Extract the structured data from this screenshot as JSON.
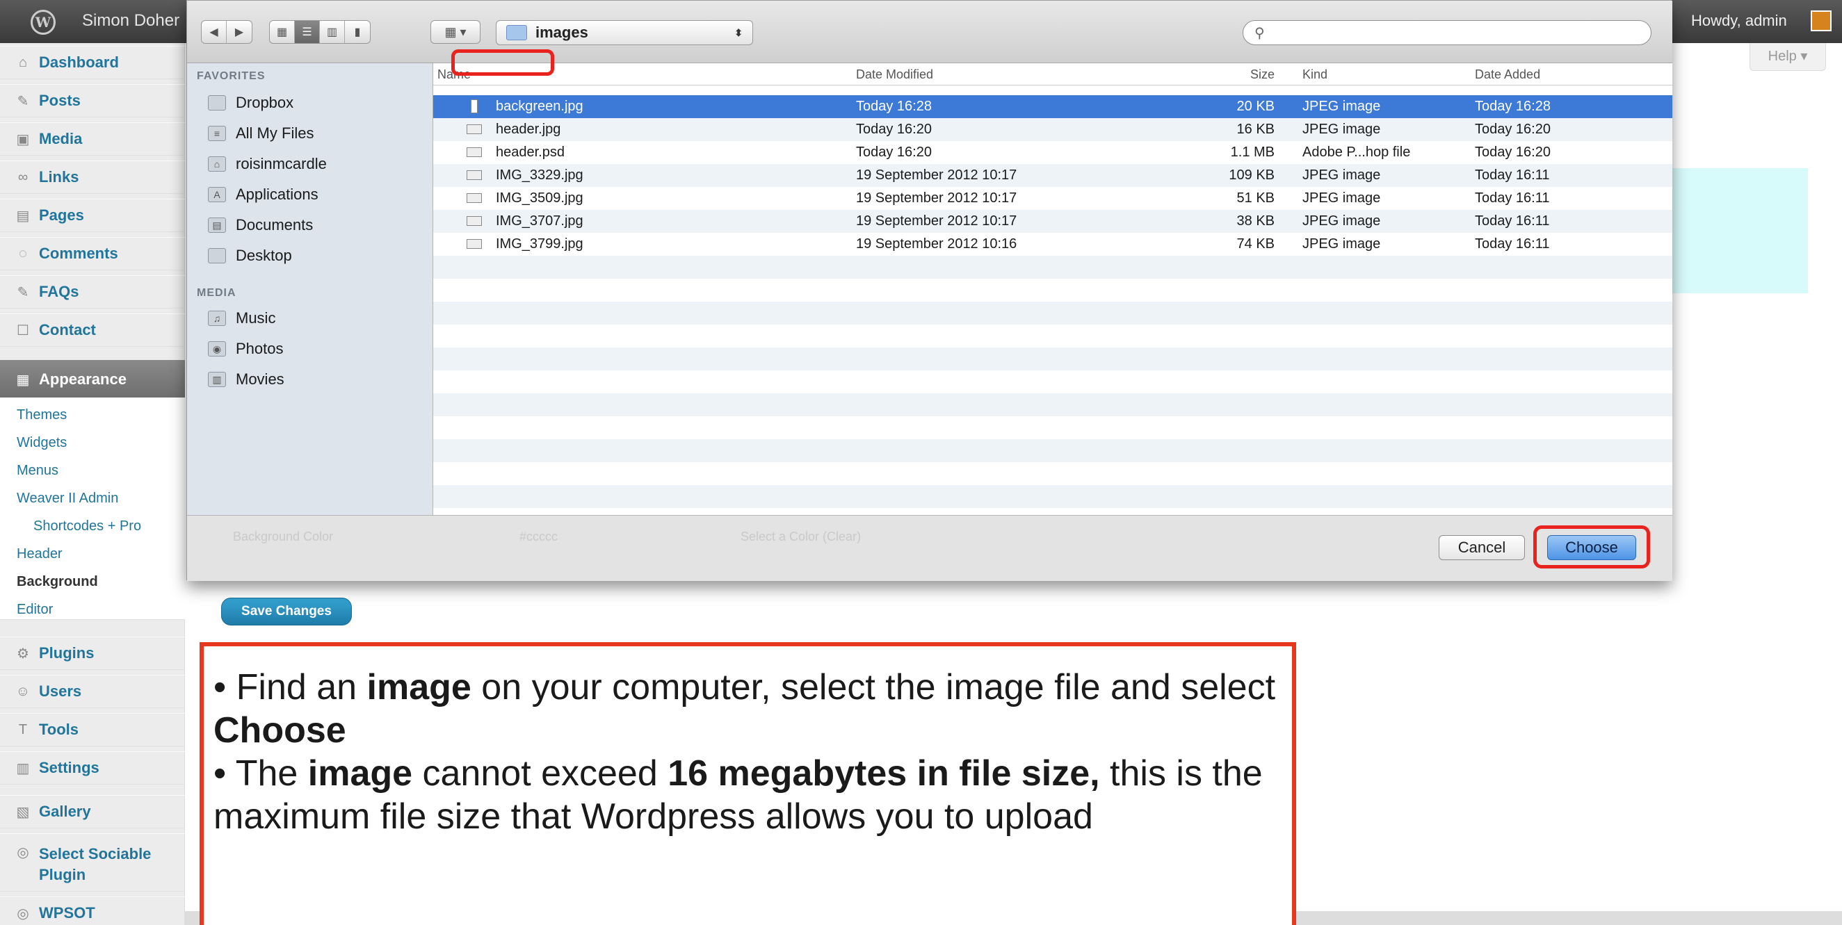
{
  "admin_bar": {
    "site_name": "Simon Doher",
    "howdy": "Howdy, admin",
    "help": "Help ▾"
  },
  "sidebar": {
    "items": [
      {
        "label": "Dashboard",
        "icon": "house-icon"
      },
      {
        "label": "Posts",
        "icon": "pin-icon"
      },
      {
        "label": "Media",
        "icon": "media-icon"
      },
      {
        "label": "Links",
        "icon": "link-icon"
      },
      {
        "label": "Pages",
        "icon": "page-icon"
      },
      {
        "label": "Comments",
        "icon": "comment-icon"
      },
      {
        "label": "FAQs",
        "icon": "pin-icon"
      },
      {
        "label": "Contact",
        "icon": "contact-icon"
      },
      {
        "label": "Appearance",
        "icon": "appearance-icon"
      },
      {
        "label": "Plugins",
        "icon": "plugin-icon"
      },
      {
        "label": "Users",
        "icon": "users-icon"
      },
      {
        "label": "Tools",
        "icon": "tools-icon"
      },
      {
        "label": "Settings",
        "icon": "settings-icon"
      },
      {
        "label": "Gallery",
        "icon": "gallery-icon"
      },
      {
        "label": "Select Sociable Plugin",
        "icon": "sociable-icon"
      },
      {
        "label": "WPSOT",
        "icon": "wpsot-icon"
      }
    ],
    "submenu": [
      "Themes",
      "Widgets",
      "Menus",
      "Weaver II Admin",
      "Shortcodes + Pro",
      "Header",
      "Background",
      "Editor"
    ]
  },
  "page": {
    "save_changes": "Save Changes"
  },
  "dialog": {
    "location": "images",
    "search_placeholder": "",
    "favorites_header": "FAVORITES",
    "favorites": [
      "Dropbox",
      "All My Files",
      "roisinmcardle",
      "Applications",
      "Documents",
      "Desktop"
    ],
    "media_header": "MEDIA",
    "media": [
      "Music",
      "Photos",
      "Movies"
    ],
    "columns": {
      "name": "Name",
      "date_modified": "Date Modified",
      "size": "Size",
      "kind": "Kind",
      "date_added": "Date Added"
    },
    "files": [
      {
        "name": "backgreen.jpg",
        "modified": "Today 16:28",
        "size": "20 KB",
        "kind": "JPEG image",
        "added": "Today 16:28",
        "selected": true
      },
      {
        "name": "header.jpg",
        "modified": "Today 16:20",
        "size": "16 KB",
        "kind": "JPEG image",
        "added": "Today 16:20"
      },
      {
        "name": "header.psd",
        "modified": "Today 16:20",
        "size": "1.1 MB",
        "kind": "Adobe P...hop file",
        "added": "Today 16:20"
      },
      {
        "name": "IMG_3329.jpg",
        "modified": "19 September 2012 10:17",
        "size": "109 KB",
        "kind": "JPEG image",
        "added": "Today 16:11"
      },
      {
        "name": "IMG_3509.jpg",
        "modified": "19 September 2012 10:17",
        "size": "51 KB",
        "kind": "JPEG image",
        "added": "Today 16:11"
      },
      {
        "name": "IMG_3707.jpg",
        "modified": "19 September 2012 10:17",
        "size": "38 KB",
        "kind": "JPEG image",
        "added": "Today 16:11"
      },
      {
        "name": "IMG_3799.jpg",
        "modified": "19 September 2012 10:16",
        "size": "74 KB",
        "kind": "JPEG image",
        "added": "Today 16:11"
      }
    ],
    "ghost_labels": [
      "Background Color",
      "#ccccc",
      "Select a Color (Clear)"
    ],
    "cancel": "Cancel",
    "choose": "Choose"
  },
  "note": {
    "line1_a": "• Find an ",
    "line1_b": "image",
    "line1_c": " on your computer, select the image file and select ",
    "line1_d": "Choose",
    "line2_a": "• The ",
    "line2_b": "image",
    "line2_c": " cannot exceed ",
    "line2_d": "16 megabytes in file size,",
    "line2_e": " this is the maximum file size that Wordpress allows you to upload"
  },
  "colors": {
    "wp_link": "#21759b",
    "selection": "#3d79d6",
    "annotation_red": "#e8231d"
  }
}
